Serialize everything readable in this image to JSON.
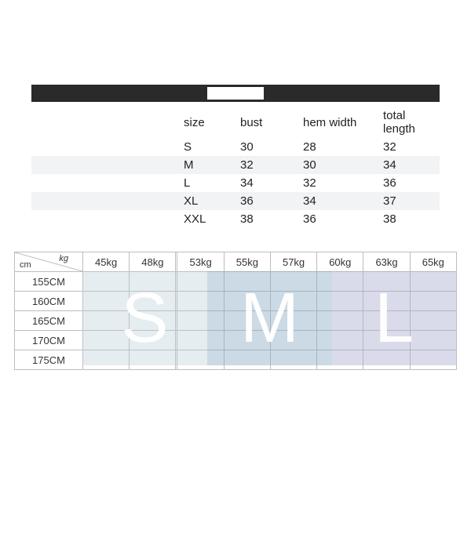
{
  "size_table": {
    "headers": [
      "size",
      "bust",
      "hem width",
      "total length"
    ],
    "rows": [
      {
        "size": "S",
        "bust": "30",
        "hem": "28",
        "len": "32"
      },
      {
        "size": "M",
        "bust": "32",
        "hem": "30",
        "len": "34"
      },
      {
        "size": "L",
        "bust": "34",
        "hem": "32",
        "len": "36"
      },
      {
        "size": "XL",
        "bust": "36",
        "hem": "34",
        "len": "37"
      },
      {
        "size": "XXL",
        "bust": "38",
        "hem": "36",
        "len": "38"
      }
    ]
  },
  "reco_table": {
    "corner": {
      "row_unit": "cm",
      "col_unit": "kg"
    },
    "col_headers": [
      "45kg",
      "48kg",
      "",
      "53kg",
      "55kg",
      "57kg",
      "60kg",
      "63kg",
      "65kg"
    ],
    "row_headers": [
      "155CM",
      "160CM",
      "165CM",
      "170CM",
      "175CM"
    ],
    "zones": [
      {
        "label": "S",
        "cols": "1-3"
      },
      {
        "label": "M",
        "cols": "4-6"
      },
      {
        "label": "L",
        "cols": "7-9"
      }
    ]
  }
}
